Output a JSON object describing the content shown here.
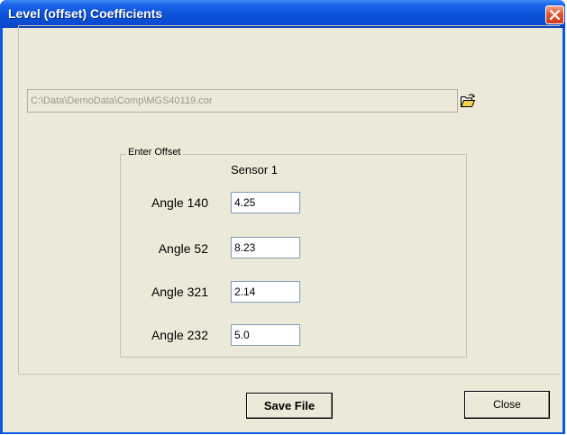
{
  "window": {
    "title": "Level (offset) Coefficients"
  },
  "file": {
    "path": "C:\\Data\\DemoData\\Comp\\MGS40119.cor"
  },
  "offset_group": {
    "legend": "Enter Offset",
    "sensor_header": "Sensor 1",
    "rows": [
      {
        "label": "Angle 140",
        "value": "4.25"
      },
      {
        "label": "Angle 52",
        "value": "8.23"
      },
      {
        "label": "Angle 321",
        "value": "2.14"
      },
      {
        "label": "Angle 232",
        "value": "5.0"
      }
    ]
  },
  "buttons": {
    "save": "Save File",
    "close": "Close"
  },
  "icons": {
    "close": "close-icon",
    "browse": "open-folder-icon"
  }
}
